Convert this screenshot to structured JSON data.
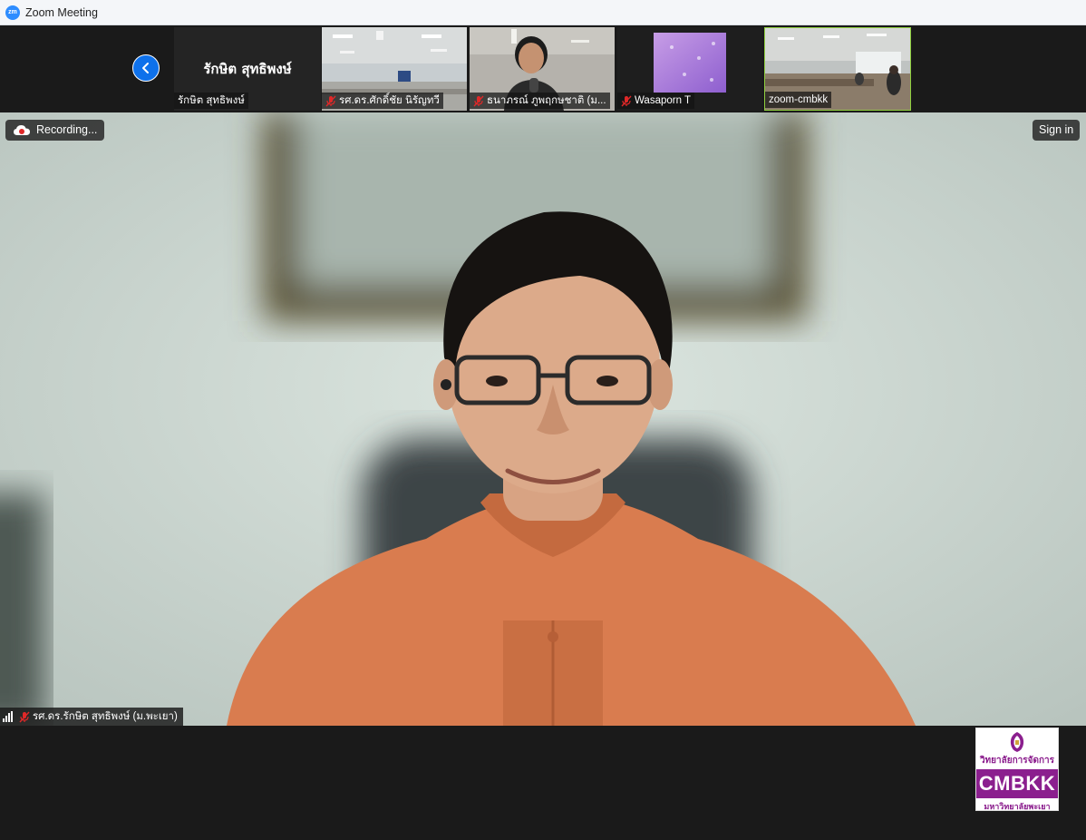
{
  "window": {
    "title": "Zoom Meeting",
    "app_icon": "zoom-logo"
  },
  "thumbnails": {
    "active_speaker_tile": {
      "display_name": "รักษิต สุทธิพงษ์",
      "name_label": "รักษิต สุทธิพงษ์"
    },
    "participants": [
      {
        "name": "รศ.ดร.ศักดิ์ชัย นิรัญทวี",
        "muted": true
      },
      {
        "name": "ธนาภรณ์ ภูพฤกษชาติ (ม...",
        "muted": true
      },
      {
        "name": "Wasaporn T",
        "muted": true
      },
      {
        "name": "zoom-cmbkk",
        "muted": false
      }
    ]
  },
  "main": {
    "recording_label": "Recording...",
    "sign_in_label": "Sign in",
    "speaker_label": "รศ.ดร.รักษิต สุทธิพงษ์ (ม.พะเยา)"
  },
  "logo": {
    "top_text": "วิทยาลัยการจัดการ",
    "main_text": "CMBKK",
    "bottom_text": "มหาวิทยาลัยพะเยา"
  },
  "colors": {
    "accent": "#0e71eb",
    "brand_purple": "#8b1f8e",
    "muted_red": "#e02828"
  }
}
